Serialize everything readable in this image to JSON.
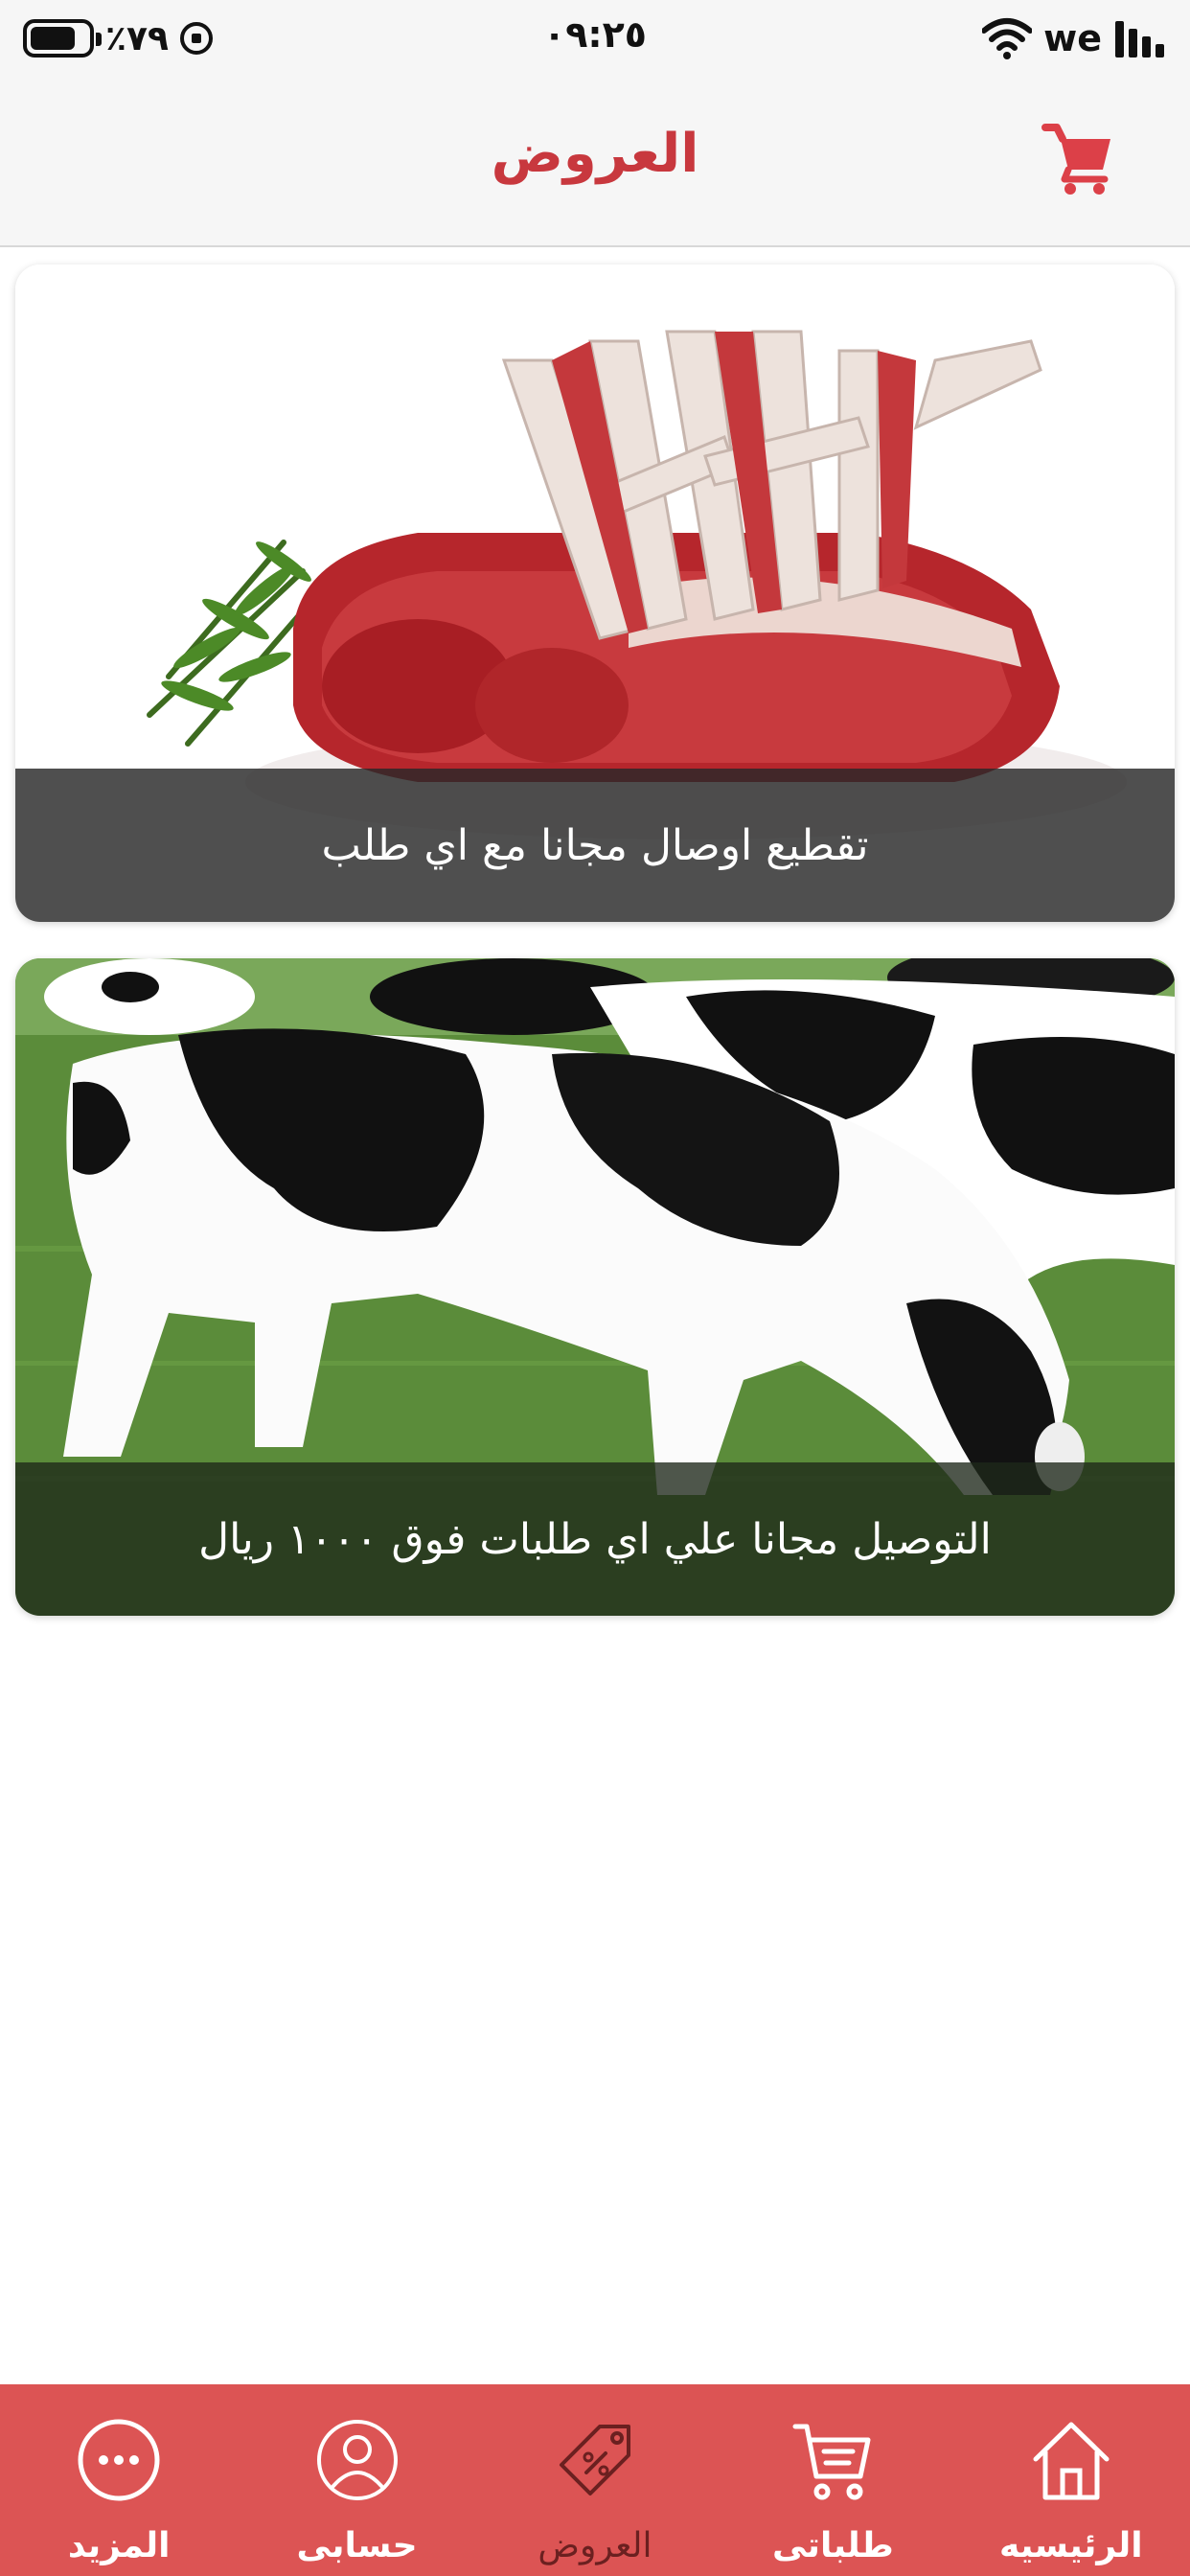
{
  "status_bar": {
    "battery_percent": "٪٧٩",
    "time": "٠٩:٢٥",
    "carrier": "we"
  },
  "header": {
    "title": "العروض",
    "cart_icon": "cart-icon"
  },
  "offers": [
    {
      "caption": "تقطيع اوصال مجانا مع اي طلب",
      "image": "lamb-rack-photo"
    },
    {
      "caption": "التوصيل مجانا علي اي  طلبات فوق ١٠٠٠ ريال",
      "image": "cows-grazing-photo"
    }
  ],
  "tab_bar": {
    "items": [
      {
        "label": "الرئيسيه",
        "icon": "home-icon"
      },
      {
        "label": "طلباتى",
        "icon": "cart-list-icon"
      },
      {
        "label": "العروض",
        "icon": "offer-tag-icon",
        "active": true
      },
      {
        "label": "حسابى",
        "icon": "user-icon"
      },
      {
        "label": "المزيد",
        "icon": "more-icon"
      }
    ],
    "colors": {
      "background": "#dc5454",
      "active_label": "#6b2020"
    }
  },
  "colors": {
    "accent": "#c8383e"
  }
}
